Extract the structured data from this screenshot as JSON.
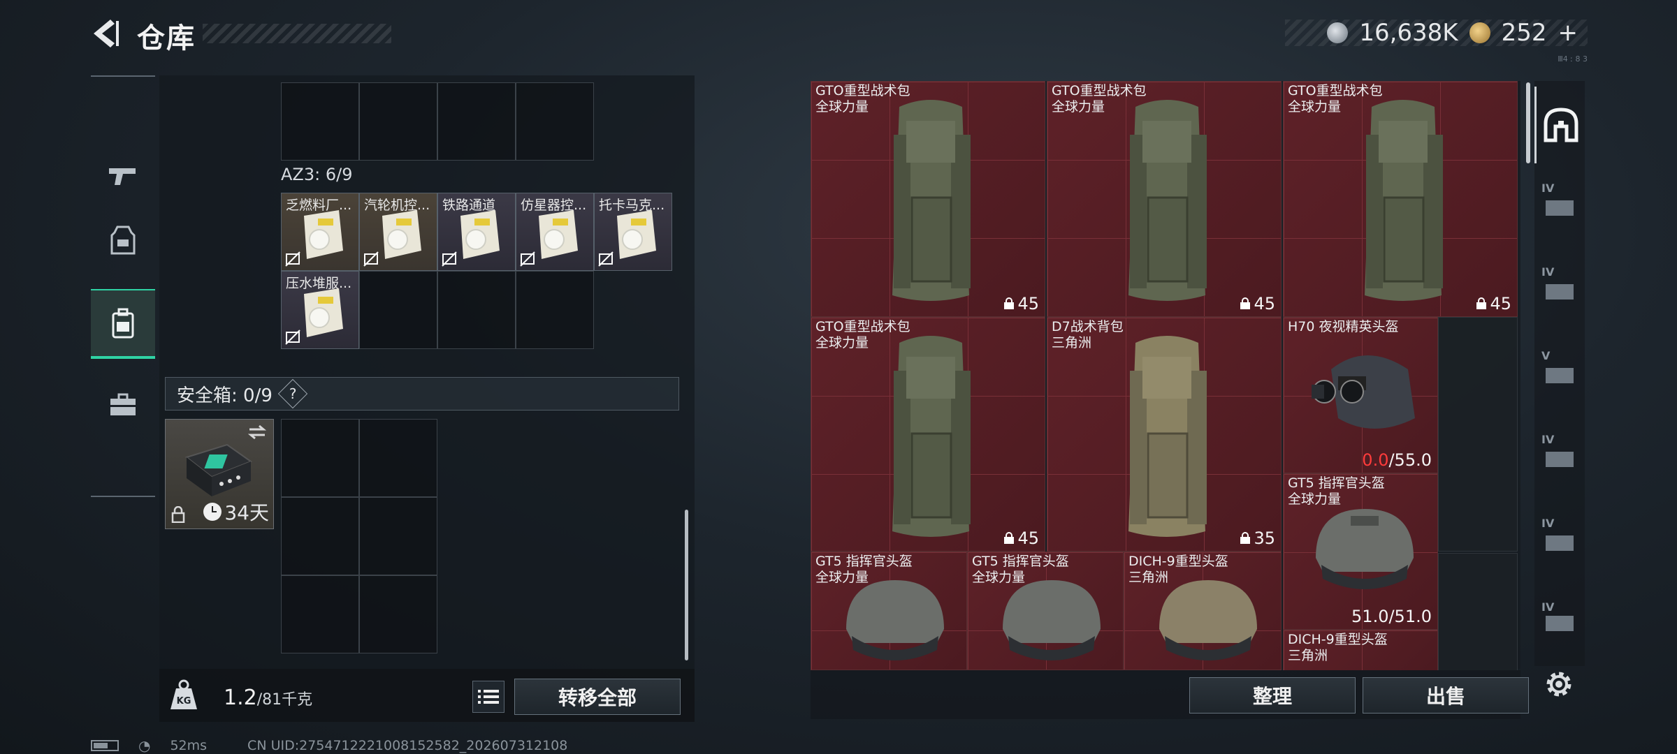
{
  "header": {
    "title": "仓库",
    "currency_primary": "16,638K",
    "currency_secondary": "252",
    "currency_secondary_plus": "+",
    "small_text": "Ⅲ4 ː 8 3"
  },
  "left_rail": {
    "items": [
      {
        "name": "weapons",
        "icon": "pistol-icon"
      },
      {
        "name": "armor",
        "icon": "vest-icon"
      },
      {
        "name": "backpack",
        "icon": "backpack-icon"
      },
      {
        "name": "case",
        "icon": "briefcase-icon"
      }
    ],
    "active_index": 2
  },
  "storage": {
    "az3_label": "AZ3: 6/9",
    "keys": [
      {
        "label": "乏燃料厂..."
      },
      {
        "label": "汽轮机控..."
      },
      {
        "label": "铁路通道"
      },
      {
        "label": "仿星器控..."
      },
      {
        "label": "托卡马克..."
      },
      {
        "label": "压水堆服..."
      }
    ],
    "safebox_label": "安全箱: 0/9",
    "safebox_help": "?",
    "safebox_days": "34天",
    "weight_value": "1.2",
    "weight_max": "/81千克",
    "transfer_all_button": "转移全部"
  },
  "right_grid": {
    "items": [
      {
        "name": "GTO重型战术包",
        "source": "全球力量",
        "count": "45"
      },
      {
        "name": "GTO重型战术包",
        "source": "全球力量",
        "count": "45"
      },
      {
        "name": "GTO重型战术包",
        "source": "全球力量",
        "count": "45"
      },
      {
        "name": "GTO重型战术包",
        "source": "全球力量",
        "count": "45"
      },
      {
        "name": "D7战术背包",
        "source": "三角洲",
        "count": "35"
      },
      {
        "name": "H70 夜视精英头盔",
        "durability_current": "0.0",
        "durability_max": "/55.0"
      },
      {
        "name": "GT5 指挥官头盔",
        "source": "全球力量",
        "durability": "51.0/51.0"
      },
      {
        "name": "GT5 指挥官头盔",
        "source": "全球力量"
      },
      {
        "name": "GT5 指挥官头盔",
        "source": "全球力量"
      },
      {
        "name": "DICH-9重型头盔",
        "source": "三角洲"
      },
      {
        "name": "DICH-9重型头盔",
        "source": "三角洲"
      }
    ],
    "sort_button": "整理",
    "sell_button": "出售"
  },
  "side_tabs": [
    "IV",
    "IV",
    "V",
    "IV",
    "IV",
    "IV",
    "IV"
  ],
  "status": {
    "ping": "52ms",
    "uid": "CN UID:2754712221008152582_202607312108"
  },
  "colors": {
    "accent": "#2fd3a4",
    "item_bg_red": "#5a1f25",
    "low_durability": "#ff3b3b"
  }
}
